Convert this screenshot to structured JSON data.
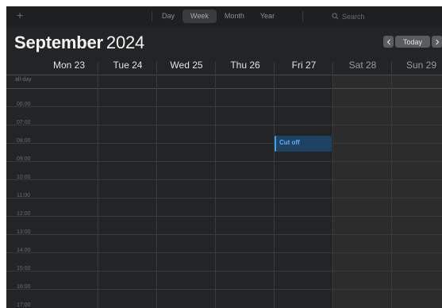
{
  "toolbar": {
    "add_icon": "plus-icon",
    "views": [
      "Day",
      "Week",
      "Month",
      "Year"
    ],
    "active_view": "Week",
    "search_placeholder": "Search",
    "search_value": "",
    "search_icon": "magnifier-icon"
  },
  "header": {
    "month": "September",
    "year": "2024",
    "today_label": "Today",
    "prev_icon": "chevron-left-icon",
    "next_icon": "chevron-right-icon"
  },
  "days": [
    {
      "label": "Mon 23",
      "weekend": false
    },
    {
      "label": "Tue 24",
      "weekend": false
    },
    {
      "label": "Wed 25",
      "weekend": false
    },
    {
      "label": "Thu 26",
      "weekend": false
    },
    {
      "label": "Fri 27",
      "weekend": false
    },
    {
      "label": "Sat 28",
      "weekend": true
    },
    {
      "label": "Sun 29",
      "weekend": true
    }
  ],
  "allday_label": "all-day",
  "hours": [
    "06:00",
    "07:00",
    "08:00",
    "09:00",
    "10:00",
    "11:00",
    "12:00",
    "13:00",
    "14:00",
    "15:00",
    "16:00",
    "17:00"
  ],
  "events": [
    {
      "title": "Cut off",
      "day": "Fri 27",
      "start": "08:15",
      "end": "09:00",
      "color": "#3d9ff0"
    }
  ],
  "colors": {
    "background": "#232425",
    "weekend_shade": "#2c2c2d",
    "event_fill": "#1e4261",
    "event_accent": "#3d9ff0",
    "event_text": "#5bb0ff"
  }
}
